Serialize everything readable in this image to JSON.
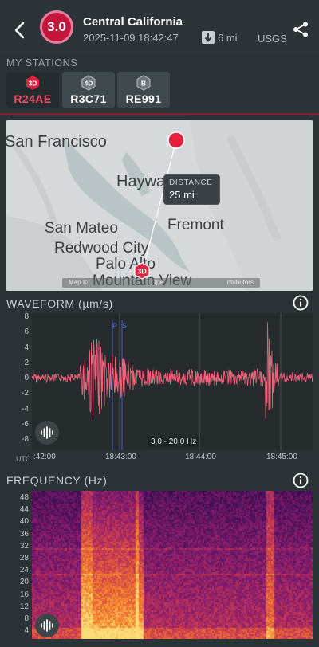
{
  "header": {
    "magnitude": "3.0",
    "title": "Central California",
    "datetime": "2025-11-09 18:42:47",
    "distance": "6 mi",
    "source": "USGS",
    "colors": {
      "accent": "#c2163b",
      "accent_ring": "#e87da0"
    }
  },
  "stations": {
    "label": "MY STATIONS",
    "items": [
      {
        "badge": "3D",
        "code": "R24AE",
        "active": true,
        "color": "#e0213f"
      },
      {
        "badge": "4D",
        "code": "R3C71",
        "active": false,
        "color": "#6d7579"
      },
      {
        "badge": "B",
        "code": "RE991",
        "active": false,
        "color": "#6d7579"
      }
    ]
  },
  "map": {
    "cities": [
      "San Francisco",
      "Haywa",
      "Fremont",
      "San Mateo",
      "Redwood City",
      "Palo Alto",
      "Mountain View"
    ],
    "distance_label": "DISTANCE",
    "distance_value": "25 mi",
    "station_badge": "3D",
    "attribution_left": "Map ©",
    "attribution_right": "ntributors",
    "attribution_mid": "Ope"
  },
  "waveform": {
    "title": "WAVEFORM (µm/s)",
    "y_ticks": [
      "8",
      "6",
      "4",
      "2",
      "0",
      "-2",
      "-4",
      "-6",
      "-8"
    ],
    "x_ticks": [
      ":42:00",
      "18:43:00",
      "18:44:00",
      "18:45:00"
    ],
    "utc_label": "UTC",
    "filter_label": "3.0 - 20.0 Hz",
    "p_label": "P",
    "s_label": "S",
    "color": "#f0607a"
  },
  "frequency": {
    "title": "FREQUENCY (Hz)",
    "y_ticks": [
      "48",
      "44",
      "40",
      "36",
      "32",
      "28",
      "24",
      "20",
      "16",
      "12",
      "8",
      "4"
    ]
  }
}
